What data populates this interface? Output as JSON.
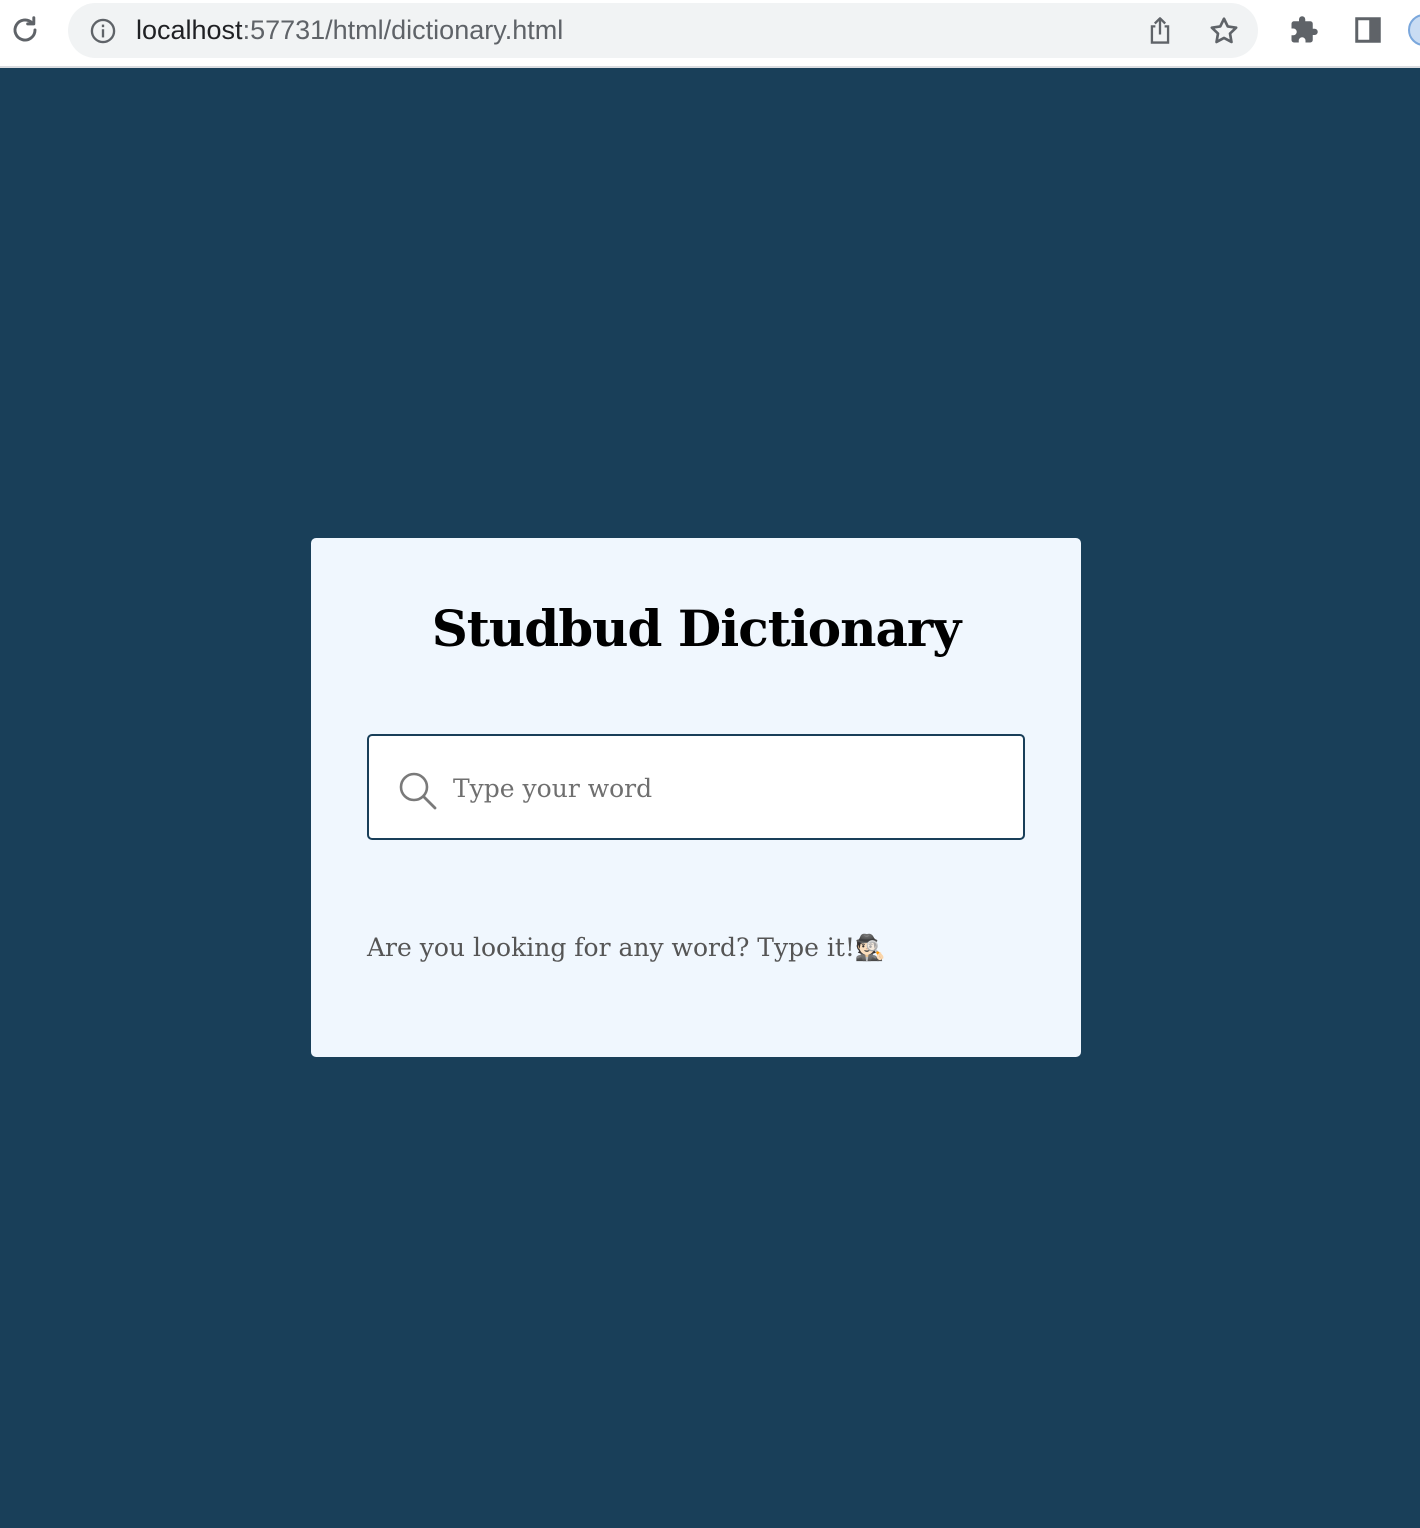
{
  "browser": {
    "url_host": "localhost",
    "url_rest": ":57731/html/dictionary.html",
    "icons": [
      "reload-icon",
      "info-icon",
      "share-icon",
      "star-icon",
      "extensions-icon",
      "side-panel-icon",
      "profile-avatar"
    ]
  },
  "page": {
    "title": "Studbud Dictionary",
    "search": {
      "placeholder": "Type your word",
      "value": "",
      "icon": "search-icon"
    },
    "hint": "Are you looking for any word? Type it!🕵🏻"
  },
  "colors": {
    "page_background": "#193f59",
    "card_background": "#f0f7fe",
    "input_border": "#193f59"
  }
}
